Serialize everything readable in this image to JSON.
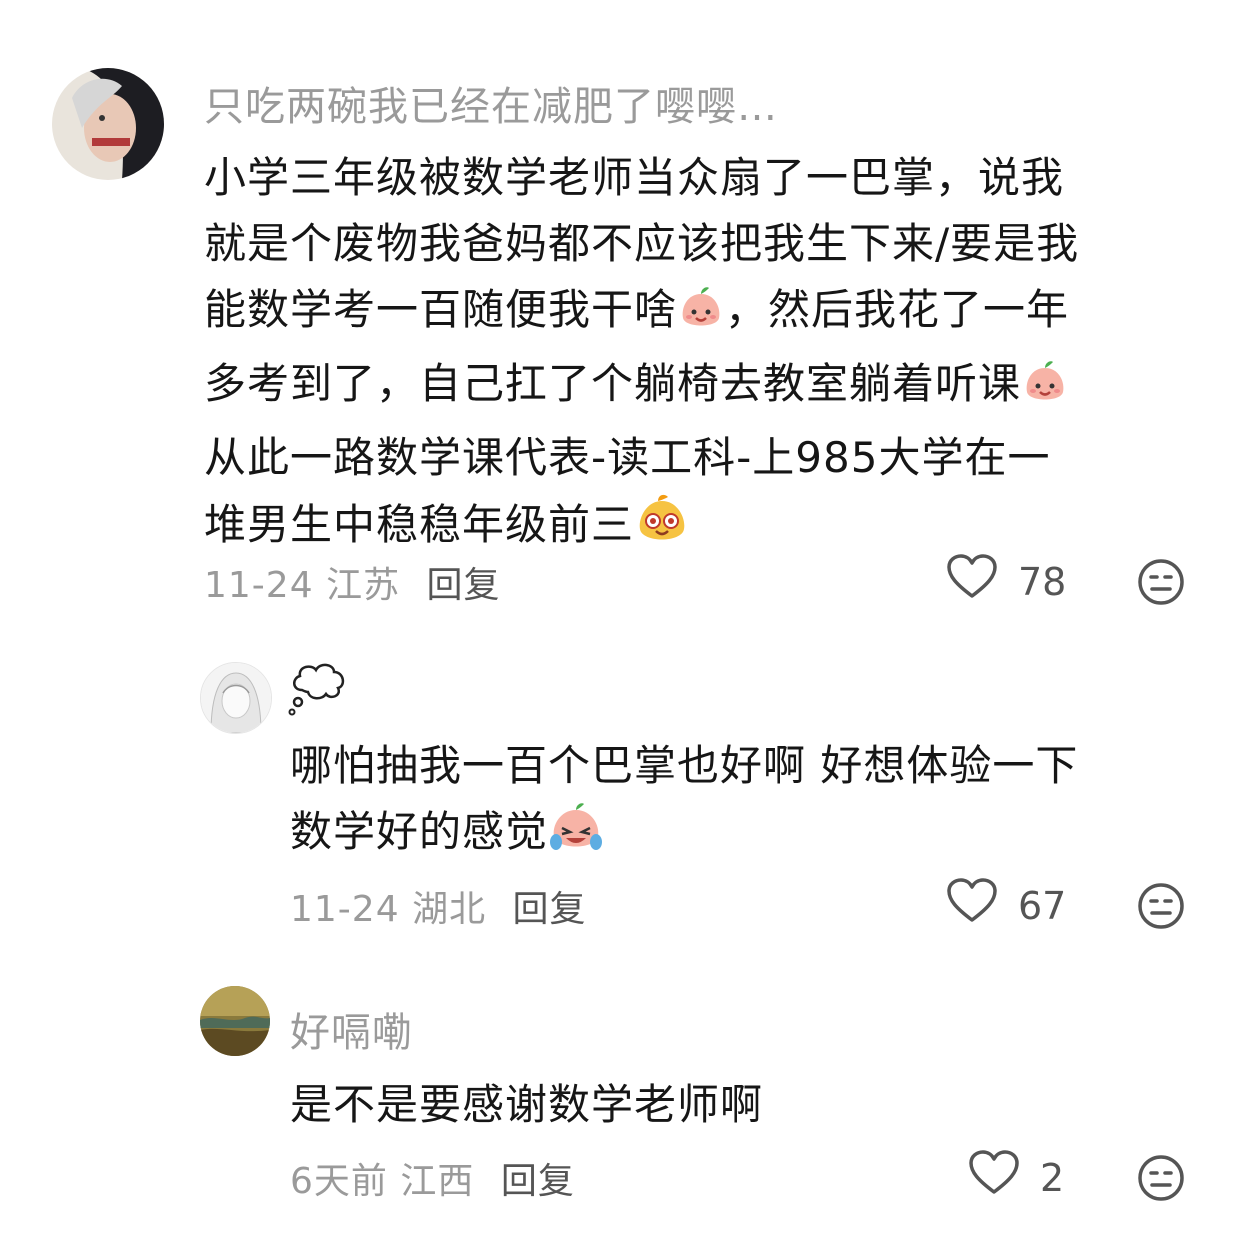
{
  "comments": [
    {
      "username": "只吃两碗我已经在减肥了嘤嘤…",
      "text_lines": [
        "小学三年级被数学老师当众扇了一巴掌，说我",
        "就是个废物我爸妈都不应该把我生下来/要是我",
        "能数学考一百随便我干啥",
        "，然后我花了一年",
        "多考到了，自己扛了个躺椅去教室躺着听课",
        "从此一路数学课代表-读工科-上985大学在一",
        "堆男生中稳稳年级前三"
      ],
      "date": "11-24",
      "location": "江苏",
      "reply_label": "回复",
      "likes": "78",
      "emojis": [
        "smiling-peach-emoji",
        "smiling-peach-emoji",
        "star-eyes-emoji"
      ]
    },
    {
      "username": "💭",
      "text_lines": [
        "哪怕抽我一百个巴掌也好啊 好想体验一下",
        "数学好的感觉"
      ],
      "date": "11-24",
      "location": "湖北",
      "reply_label": "回复",
      "likes": "67",
      "emojis": [
        "crying-laugh-peach-emoji"
      ]
    },
    {
      "username": "好嗝嘞",
      "text_lines": [
        "是不是要感谢数学老师啊"
      ],
      "date": "6天前",
      "location": "江西",
      "reply_label": "回复",
      "likes": "2",
      "emojis": []
    }
  ],
  "colors": {
    "text": "#161616",
    "muted": "#9a9a9a",
    "icon": "#555555",
    "peach": "#f7b3a6"
  }
}
